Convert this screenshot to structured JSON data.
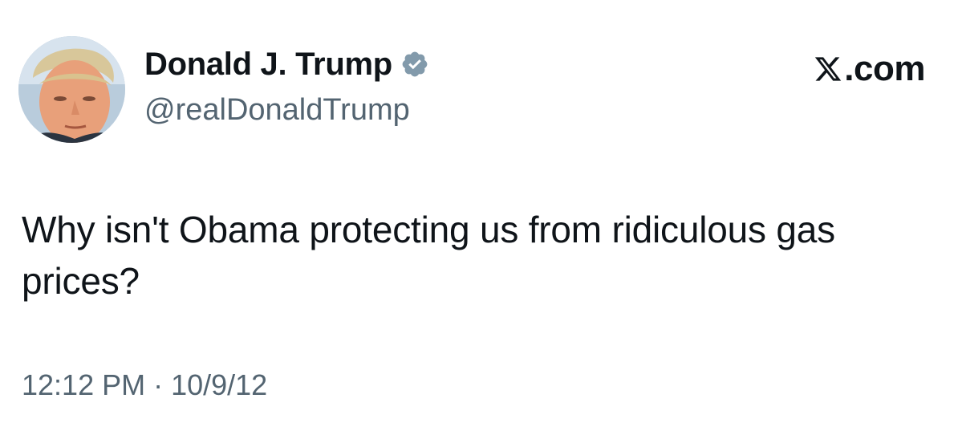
{
  "tweet": {
    "display_name": "Donald J. Trump",
    "handle": "@realDonaldTrump",
    "verified_icon": "verified-badge-icon",
    "text": "Why isn't Obama protecting us from ridiculous gas prices?",
    "time": "12:12 PM",
    "separator": "·",
    "date": "10/9/12"
  },
  "brand": {
    "text": ".com",
    "icon": "x-logo-icon"
  },
  "colors": {
    "primary_text": "#0f1419",
    "secondary_text": "#536471",
    "verified_badge": "#829aab",
    "background": "#ffffff"
  }
}
